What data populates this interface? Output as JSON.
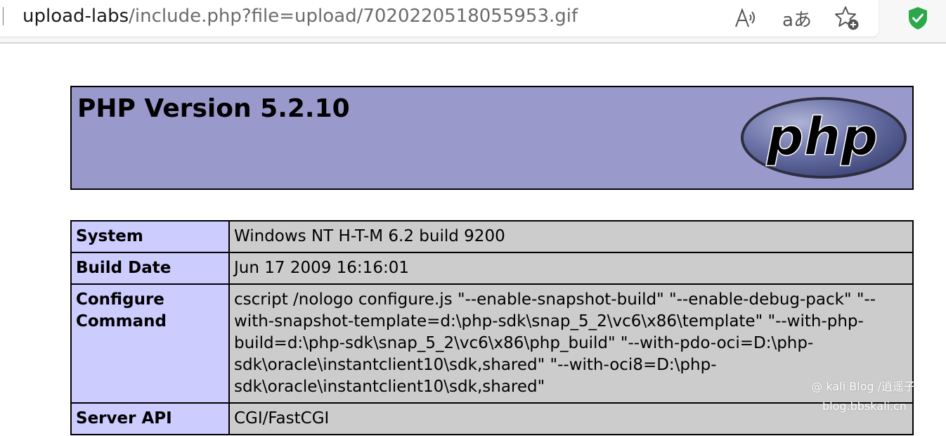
{
  "browser": {
    "url_host": "upload-labs",
    "url_path": "/include.php?file=upload/7020220518055953.gif",
    "read_aloud_icon": "read-aloud-icon",
    "translate_glyph": "aあ",
    "favorite_icon": "add-favorite-icon",
    "extension_icon": "shield-check-icon",
    "accent_color": "#2aa84a"
  },
  "phpinfo": {
    "title": "PHP Version 5.2.10",
    "logo_text": "php",
    "rows": [
      {
        "label": "System",
        "value_lines": [
          "Windows NT H-T-M 6.2 build 9200"
        ]
      },
      {
        "label": "Build Date",
        "value_lines": [
          "Jun 17 2009 16:16:01"
        ]
      },
      {
        "label": "Configure Command",
        "value_lines": [
          "cscript /nologo configure.js \"--enable-snapshot-build\" \"--enable-debug-pack\" \"--",
          "with-snapshot-template=d:\\php-sdk\\snap_5_2\\vc6\\x86\\template\" \"--with-php-",
          "build=d:\\php-sdk\\snap_5_2\\vc6\\x86\\php_build\" \"--with-pdo-oci=D:\\php-",
          "sdk\\oracle\\instantclient10\\sdk,shared\" \"--with-oci8=D:\\php-",
          "sdk\\oracle\\instantclient10\\sdk,shared\""
        ]
      },
      {
        "label": "Server API",
        "value_lines": [
          "CGI/FastCGI"
        ]
      }
    ],
    "colors": {
      "header_bg": "#9999cc",
      "label_bg": "#ccccff",
      "value_bg": "#cccccc"
    }
  },
  "watermark": {
    "line1": "@ kali Blog /逍遥子",
    "line2": "blog.bbskali.cn"
  }
}
